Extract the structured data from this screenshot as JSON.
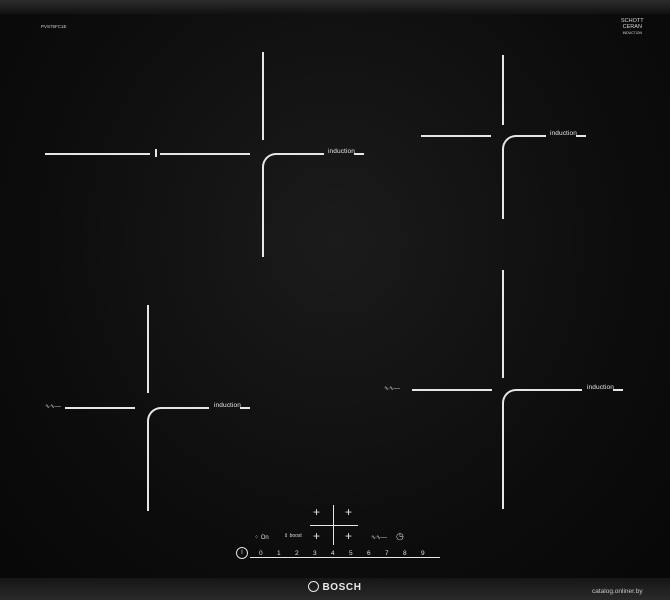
{
  "hob": {
    "model": "PVS75FC1E",
    "zone_label": "induction",
    "schott_line1": "SCHOTT",
    "schott_line2": "CERAN",
    "schott_line3": "INDUCTION",
    "flex_symbol": "∿∿―",
    "brand": "BOSCH",
    "watermark": "catalog.onliner.by"
  },
  "controls": {
    "plus_symbol": "+",
    "minus_symbol": "−",
    "power_symbol": "I",
    "move_symbol": "⁘ On",
    "boost_symbol": "⇕ boost",
    "timer_symbol": "◷",
    "scale": [
      "0",
      "1",
      "2",
      "3",
      "4",
      "5",
      "6",
      "7",
      "8",
      "9"
    ]
  }
}
